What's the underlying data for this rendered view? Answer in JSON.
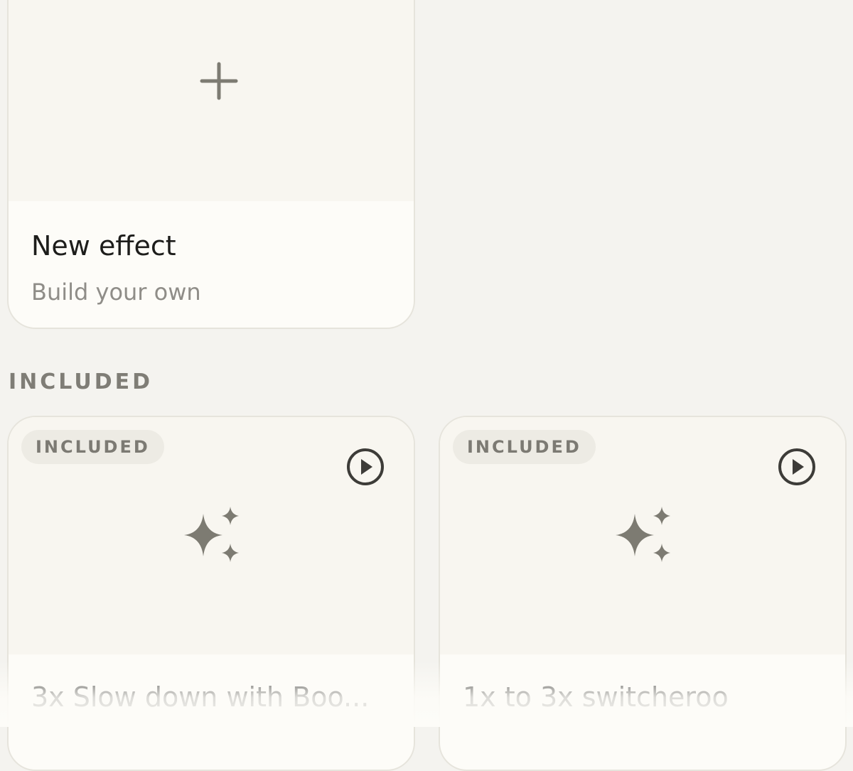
{
  "new_effect_card": {
    "title": "New effect",
    "subtitle": "Build your own",
    "icon": "plus-icon"
  },
  "included_section": {
    "header": "INCLUDED",
    "cards": [
      {
        "badge": "INCLUDED",
        "title": "3x Slow down with Boo...",
        "icon": "sparkle-icon",
        "action_icon": "play-icon"
      },
      {
        "badge": "INCLUDED",
        "title": "1x to 3x switcheroo",
        "icon": "sparkle-icon",
        "action_icon": "play-icon"
      }
    ]
  },
  "colors": {
    "background": "#f4f3ef",
    "card": "#fdfcf8",
    "icon": "#7d7b72",
    "text": "#1d1d1b",
    "muted_text": "#8f8d88"
  }
}
